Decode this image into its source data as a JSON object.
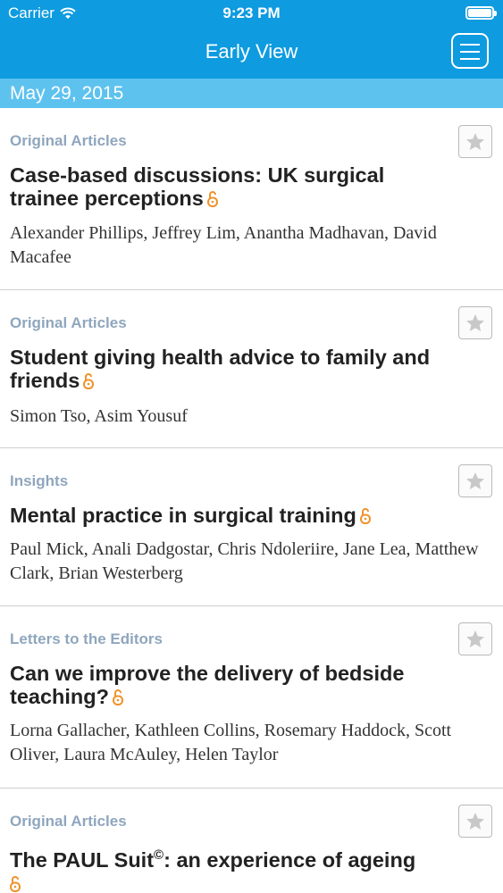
{
  "status": {
    "carrier": "Carrier",
    "time": "9:23 PM"
  },
  "nav": {
    "title": "Early View"
  },
  "date": "May 29, 2015",
  "colors": {
    "accent": "#0e9be0",
    "date_bar": "#5ec2ef",
    "category": "#8fa6bd",
    "lock": "#f0922a"
  },
  "articles": [
    {
      "category": "Original Articles",
      "title": "Case-based discussions: UK surgical trainee perceptions",
      "authors": "Alexander Phillips, Jeffrey Lim, Anantha Madhavan, David Macafee"
    },
    {
      "category": "Original Articles",
      "title": "Student giving health advice to family and friends",
      "authors": "Simon Tso, Asim Yousuf"
    },
    {
      "category": "Insights",
      "title": "Mental practice in surgical training",
      "authors": "Paul Mick, Anali Dadgostar, Chris Ndoleriire, Jane Lea, Matthew Clark, Brian Westerberg"
    },
    {
      "category": "Letters to the Editors",
      "title": "Can we improve the delivery of bedside teaching?",
      "authors": "Lorna Gallacher, Kathleen Collins, Rosemary Haddock, Scott Oliver, Laura McAuley, Helen Taylor"
    },
    {
      "category": "Original Articles",
      "title": "The PAUL Suit",
      "title_superscript": "©",
      "title_rest": ": an experience of ageing",
      "authors": ""
    }
  ]
}
